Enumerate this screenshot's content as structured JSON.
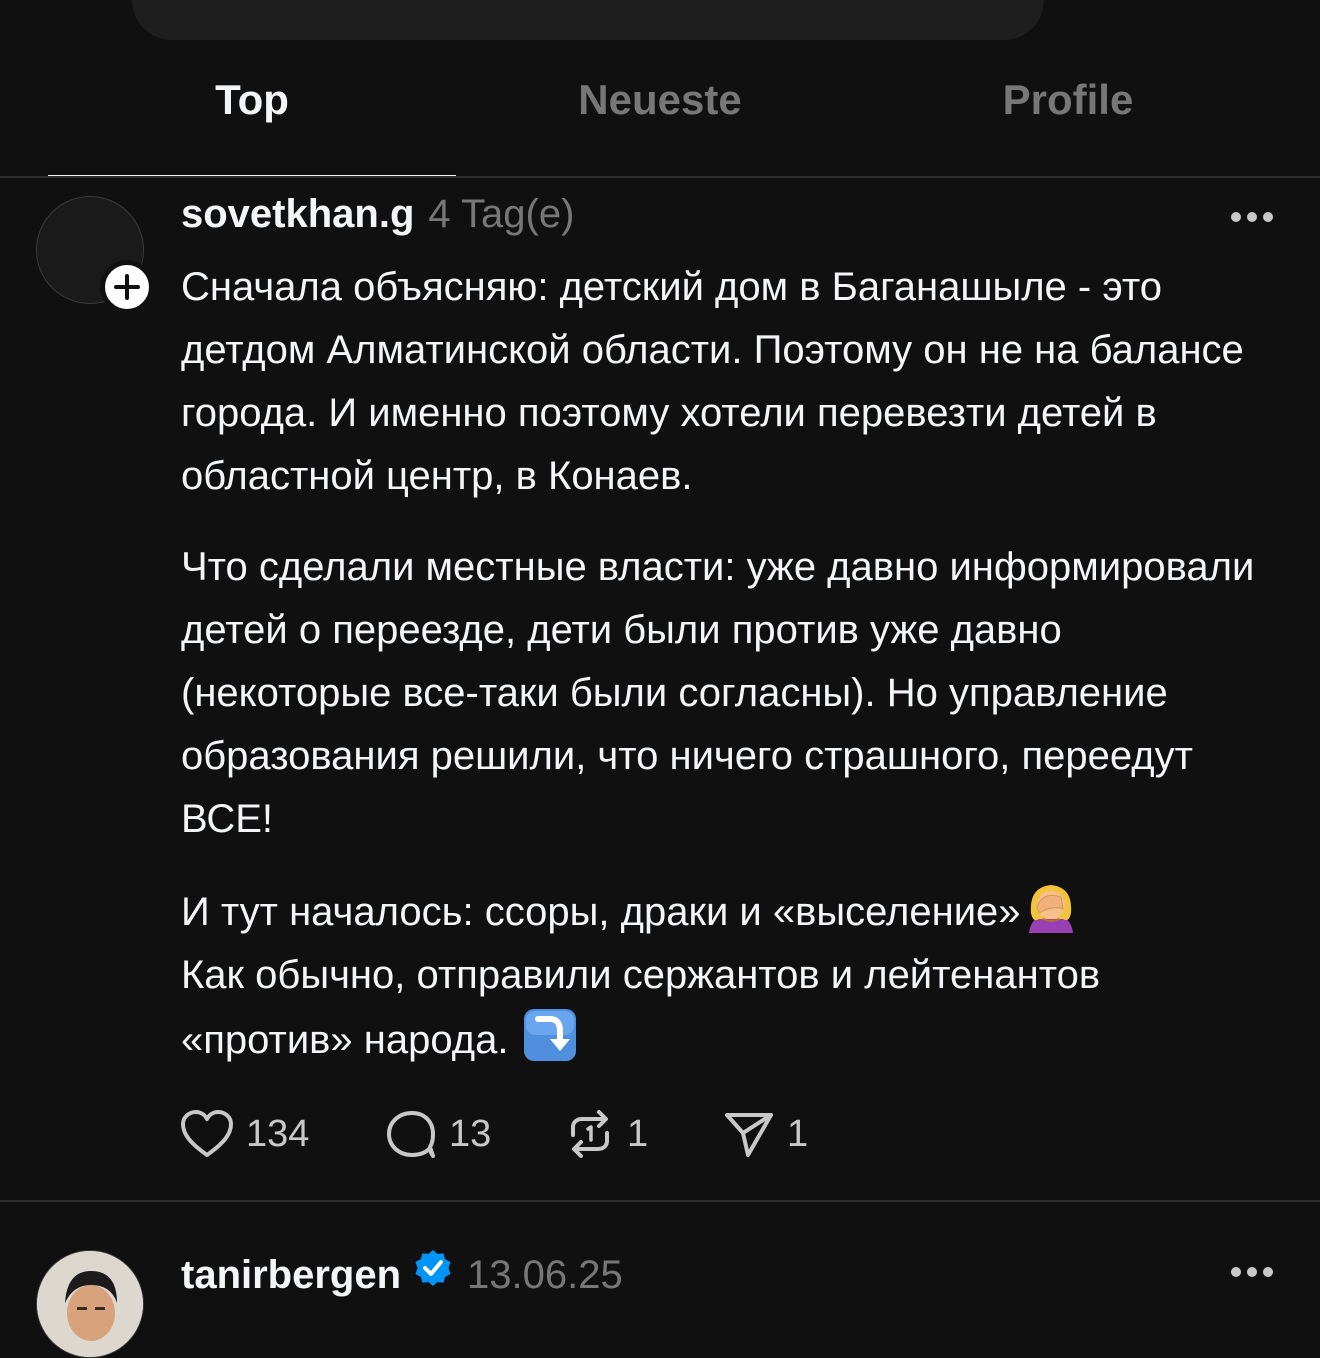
{
  "tabs": [
    {
      "label": "Top",
      "active": true
    },
    {
      "label": "Neueste",
      "active": false
    },
    {
      "label": "Profile",
      "active": false
    }
  ],
  "posts": [
    {
      "username": "sovetkhan.g",
      "time": "4 Tag(e)",
      "verified": false,
      "paragraphs": [
        "Сначала объясняю: детский дом в Баганашыле - это детдом Алматинской области. Поэтому он не на балансе города. И именно поэтому хотели перевезти детей в областной центр, в Конаев.",
        "Что сделали местные власти: уже давно информировали детей о переезде, дети были против уже давно (некоторые все-таки были согласны). Но управление образования решили, что ничего страшного, переедут ВСЕ!",
        "И тут началось: ссоры, драки и «выселение»",
        "Как обычно, отправили сержантов и лейтенантов «против» народа."
      ],
      "emojis": [
        "face-palm-emoji",
        "arrow-down-right-emoji"
      ],
      "actions": {
        "likes": "134",
        "comments": "13",
        "reposts": "1",
        "shares": "1"
      }
    },
    {
      "username": "tanirbergen",
      "time": "13.06.25",
      "verified": true
    }
  ],
  "colors": {
    "background": "#101010",
    "text_primary": "#f3f5f7",
    "text_secondary": "#777777",
    "verified_badge": "#0095f6"
  }
}
